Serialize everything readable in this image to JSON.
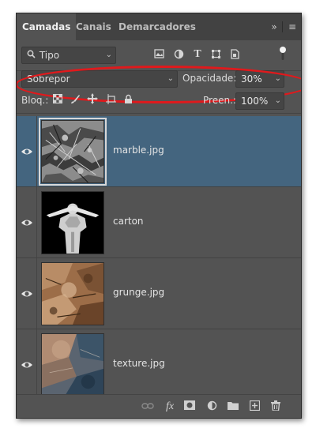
{
  "tabs": [
    {
      "label": "Camadas",
      "active": true
    },
    {
      "label": "Canais",
      "active": false
    },
    {
      "label": "Demarcadores",
      "active": false
    }
  ],
  "header_controls": {
    "collapse_icon": "double-chevron-right-icon",
    "menu_icon": "hamburger-menu-icon"
  },
  "filter": {
    "kind_value": "Tipo",
    "filter_icons": [
      "image-filter-icon",
      "adjustment-filter-icon",
      "type-filter-icon",
      "shape-filter-icon",
      "smart-object-filter-icon"
    ]
  },
  "blend": {
    "mode_value": "Sobrepor",
    "opacity_label": "Opacidade:",
    "opacity_value": "30%"
  },
  "lock": {
    "label": "Bloq.:",
    "fill_label": "Preen.:",
    "fill_value": "100%",
    "lock_icons": [
      "lock-transparent-icon",
      "lock-pixels-icon",
      "lock-position-icon",
      "lock-artboard-icon",
      "lock-all-icon"
    ]
  },
  "layers": [
    {
      "name": "marble.jpg",
      "selected": true,
      "visible": true
    },
    {
      "name": "carton",
      "selected": false,
      "visible": true
    },
    {
      "name": "grunge.jpg",
      "selected": false,
      "visible": true
    },
    {
      "name": "texture.jpg",
      "selected": false,
      "visible": true
    }
  ],
  "footer_icons": [
    "link-layers-icon",
    "fx-icon",
    "layer-mask-icon",
    "adjustment-layer-icon",
    "group-folder-icon",
    "new-layer-icon",
    "trash-icon"
  ],
  "colors": {
    "panel_bg": "#535353",
    "selected_layer": "#44657f",
    "highlight_ring": "#e0191c"
  }
}
